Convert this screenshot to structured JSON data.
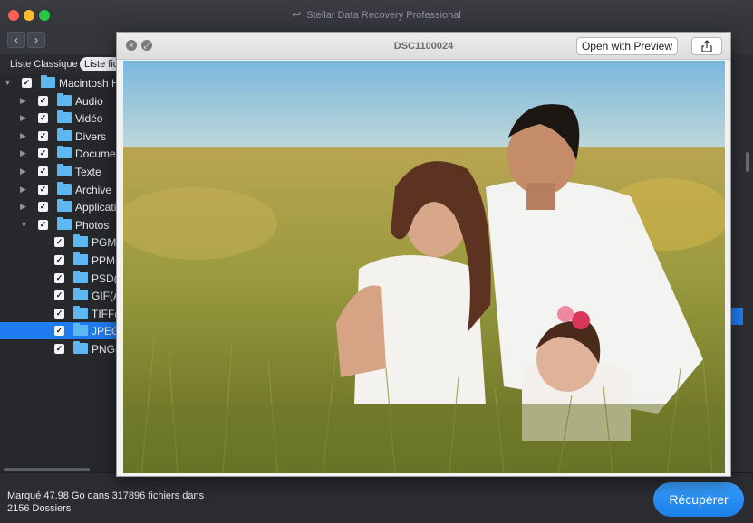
{
  "app": {
    "title": "Stellar Data Recovery Professional",
    "title_logo_icon": "stellar-logo-icon"
  },
  "nav": {
    "back": "‹",
    "forward": "›"
  },
  "tabs": [
    {
      "label": "Liste Classique",
      "active": false
    },
    {
      "label": "Liste fic",
      "active": true
    }
  ],
  "tree": [
    {
      "label": "Macintosh H",
      "level": 0,
      "expanded": true,
      "checked": true
    },
    {
      "label": "Audio",
      "level": 1,
      "expanded": false,
      "checked": true
    },
    {
      "label": "Vidéo",
      "level": 1,
      "expanded": false,
      "checked": true
    },
    {
      "label": "Divers",
      "level": 1,
      "expanded": false,
      "checked": true
    },
    {
      "label": "Documen",
      "level": 1,
      "expanded": false,
      "checked": true
    },
    {
      "label": "Texte",
      "level": 1,
      "expanded": false,
      "checked": true
    },
    {
      "label": "Archive",
      "level": 1,
      "expanded": false,
      "checked": true
    },
    {
      "label": "Applicatio",
      "level": 1,
      "expanded": false,
      "checked": true
    },
    {
      "label": "Photos",
      "level": 1,
      "expanded": true,
      "checked": true
    },
    {
      "label": "PGM(",
      "level": 2,
      "checked": true
    },
    {
      "label": "PPM(",
      "level": 2,
      "checked": true
    },
    {
      "label": "PSD(A",
      "level": 2,
      "checked": true
    },
    {
      "label": "GIF(A",
      "level": 2,
      "checked": true
    },
    {
      "label": "TIFF(A",
      "level": 2,
      "checked": true
    },
    {
      "label": "JPEG",
      "level": 2,
      "checked": true,
      "selected": true
    },
    {
      "label": "PNG(",
      "level": 2,
      "checked": true
    }
  ],
  "status": {
    "line1": "Marqué 47.98 Go dans 317896 fichiers dans",
    "line2": "2156 Dossiers"
  },
  "recover_button": "Récupérer",
  "quicklook": {
    "title": "DSC1100024",
    "open_with": "Open with Preview",
    "close_glyph": "×",
    "fullscreen_glyph": "⤢",
    "share_icon": "share-icon"
  },
  "colors": {
    "accent": "#1e7cf0",
    "folder": "#5eb7f0",
    "recover": "#1a7fe8"
  }
}
